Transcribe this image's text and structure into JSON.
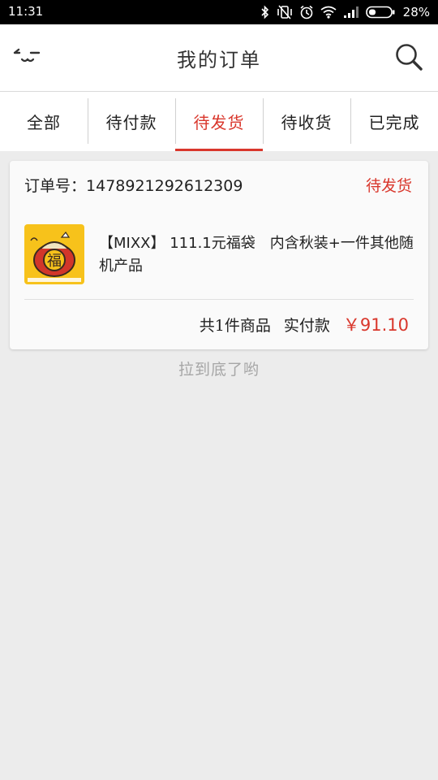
{
  "status_bar": {
    "time": "11:31",
    "battery": "28%"
  },
  "header": {
    "title": "我的订单"
  },
  "tabs": [
    {
      "label": "全部",
      "active": false
    },
    {
      "label": "待付款",
      "active": false
    },
    {
      "label": "待发货",
      "active": true
    },
    {
      "label": "待收货",
      "active": false
    },
    {
      "label": "已完成",
      "active": false
    }
  ],
  "order": {
    "number_label": "订单号：",
    "number": "1478921292612309",
    "status": "待发货",
    "product": {
      "name": "【MIXX】 111.1元福袋　内含秋装+一件其他随机产品",
      "thumb_char": "福"
    },
    "summary": {
      "count_text": "共1件商品",
      "paid_label": "实付款",
      "amount": "￥91.10"
    }
  },
  "footer": {
    "hint": "拉到底了哟"
  },
  "colors": {
    "accent": "#d9372c",
    "background": "#ececec"
  }
}
